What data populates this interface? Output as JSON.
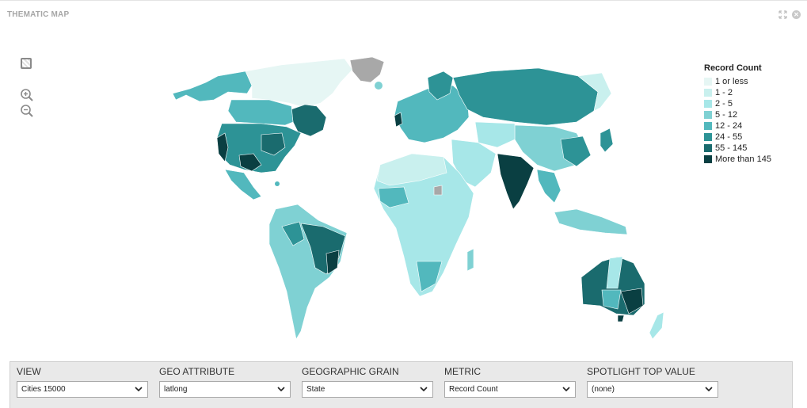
{
  "panel": {
    "title": "THEMATIC MAP"
  },
  "icons": {
    "maximize": "maximize-icon",
    "close": "close-icon",
    "select": "region-select-icon",
    "zoom_in": "zoom-in-icon",
    "zoom_out": "zoom-out-icon"
  },
  "legend": {
    "title": "Record Count",
    "items": [
      {
        "label": "1 or less",
        "color": "#e6f6f4"
      },
      {
        "label": "1 - 2",
        "color": "#c9f0ee"
      },
      {
        "label": "2 - 5",
        "color": "#a7e7e8"
      },
      {
        "label": "5 - 12",
        "color": "#7fd1d3"
      },
      {
        "label": "12 - 24",
        "color": "#52b8bd"
      },
      {
        "label": "24 - 55",
        "color": "#2d9396"
      },
      {
        "label": "55 - 145",
        "color": "#1a6b6e"
      },
      {
        "label": "More than 145",
        "color": "#0a3f42"
      }
    ],
    "no_data_color": "#a8a8a8"
  },
  "controls": {
    "view": {
      "label": "VIEW",
      "value": "Cities 15000"
    },
    "geo_attribute": {
      "label": "GEO ATTRIBUTE",
      "value": "latlong"
    },
    "geographic_grain": {
      "label": "GEOGRAPHIC GRAIN",
      "value": "State"
    },
    "metric": {
      "label": "METRIC",
      "value": "Record Count"
    },
    "spotlight": {
      "label": "SPOTLIGHT TOP VALUE",
      "value": "(none)"
    }
  }
}
